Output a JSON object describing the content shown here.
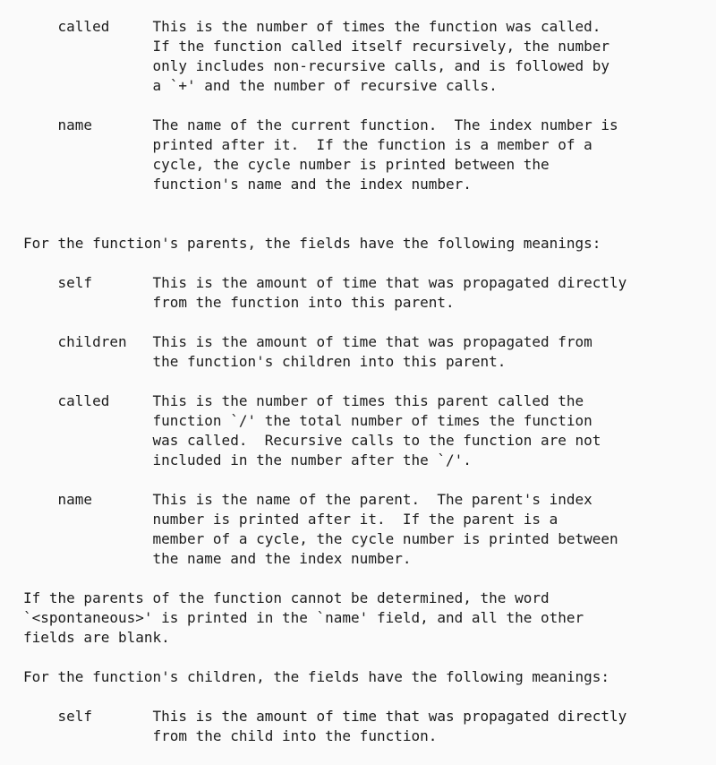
{
  "lines": [
    "    called     This is the number of times the function was called.",
    "               If the function called itself recursively, the number",
    "               only includes non-recursive calls, and is followed by",
    "               a `+' and the number of recursive calls.",
    "",
    "    name       The name of the current function.  The index number is",
    "               printed after it.  If the function is a member of a",
    "               cycle, the cycle number is printed between the",
    "               function's name and the index number.",
    "",
    "",
    "For the function's parents, the fields have the following meanings:",
    "",
    "    self       This is the amount of time that was propagated directly",
    "               from the function into this parent.",
    "",
    "    children   This is the amount of time that was propagated from",
    "               the function's children into this parent.",
    "",
    "    called     This is the number of times this parent called the",
    "               function `/' the total number of times the function",
    "               was called.  Recursive calls to the function are not",
    "               included in the number after the `/'.",
    "",
    "    name       This is the name of the parent.  The parent's index",
    "               number is printed after it.  If the parent is a",
    "               member of a cycle, the cycle number is printed between",
    "               the name and the index number.",
    "",
    "If the parents of the function cannot be determined, the word",
    "`<spontaneous>' is printed in the `name' field, and all the other",
    "fields are blank.",
    "",
    "For the function's children, the fields have the following meanings:",
    "",
    "    self       This is the amount of time that was propagated directly",
    "               from the child into the function."
  ]
}
